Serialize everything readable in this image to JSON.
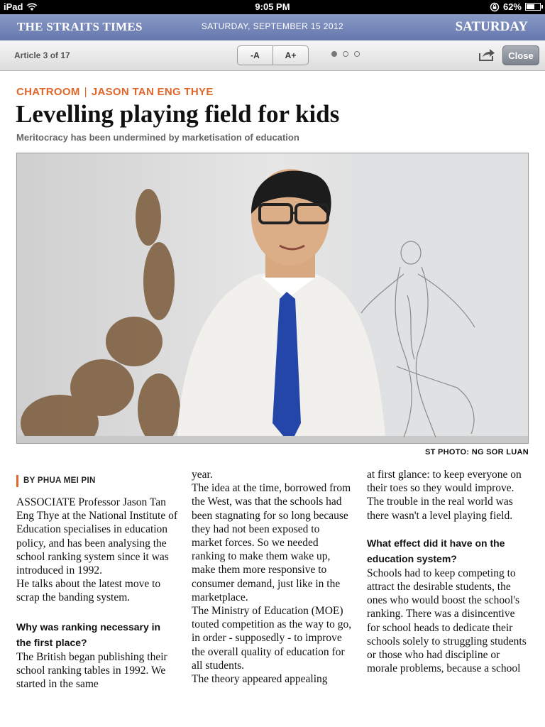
{
  "status_bar": {
    "device": "iPad",
    "time": "9:05 PM",
    "battery": "62%",
    "battery_level": 0.62
  },
  "masthead": {
    "title": "THE STRAITS TIMES",
    "date": "SATURDAY, SEPTEMBER 15 2012",
    "day": "SATURDAY"
  },
  "toolbar": {
    "article_count": "Article 3 of 17",
    "font_decrease": "-A",
    "font_increase": "A+",
    "close": "Close",
    "page_dots": 3,
    "active_dot": 0
  },
  "article": {
    "section": "CHATROOM",
    "author": "JASON TAN ENG THYE",
    "headline": "Levelling playing field for kids",
    "subhead": "Meritocracy has been undermined by marketisation of education",
    "photo_credit": "ST PHOTO: NG SOR LUAN",
    "byline": "BY PHUA MEI PIN",
    "col1": {
      "p1": "ASSOCIATE Professor Jason Tan Eng Thye at the National Institute of Education specialises in education policy, and has been analysing the school ranking system since it was introduced in 1992.",
      "p2": " He talks about the latest move to scrap the banding system.",
      "q1": "Why was ranking necessary in the first place?",
      "p3": " The British began publishing their school ranking tables in 1992. We started in the same"
    },
    "col2": {
      "p1": "year.",
      "p2": " The idea at the time, borrowed from the West, was that the schools had been stagnating for so long because they had not been exposed to market forces. So we needed ranking to make them wake up, make them more responsive to consumer demand, just like in the marketplace.",
      "p3": " The Ministry of Education (MOE) touted competition as the way to go, in order - supposedly - to improve the overall quality of education for all students.",
      "p4": " The theory appeared appealing"
    },
    "col3": {
      "p1": "at first glance: to keep everyone on their toes so they would improve. The trouble in the real world was there wasn't a level playing field.",
      "q2": "What effect did it have on the education system?",
      "p2": " Schools had to keep competing to attract the desirable students, the ones who would boost the school's ranking. There was a disincentive for school heads to dedicate their schools solely to struggling students or those who had discipline or morale problems, because a school"
    }
  },
  "colors": {
    "accent": "#e0662a",
    "masthead": "#7384b7"
  }
}
